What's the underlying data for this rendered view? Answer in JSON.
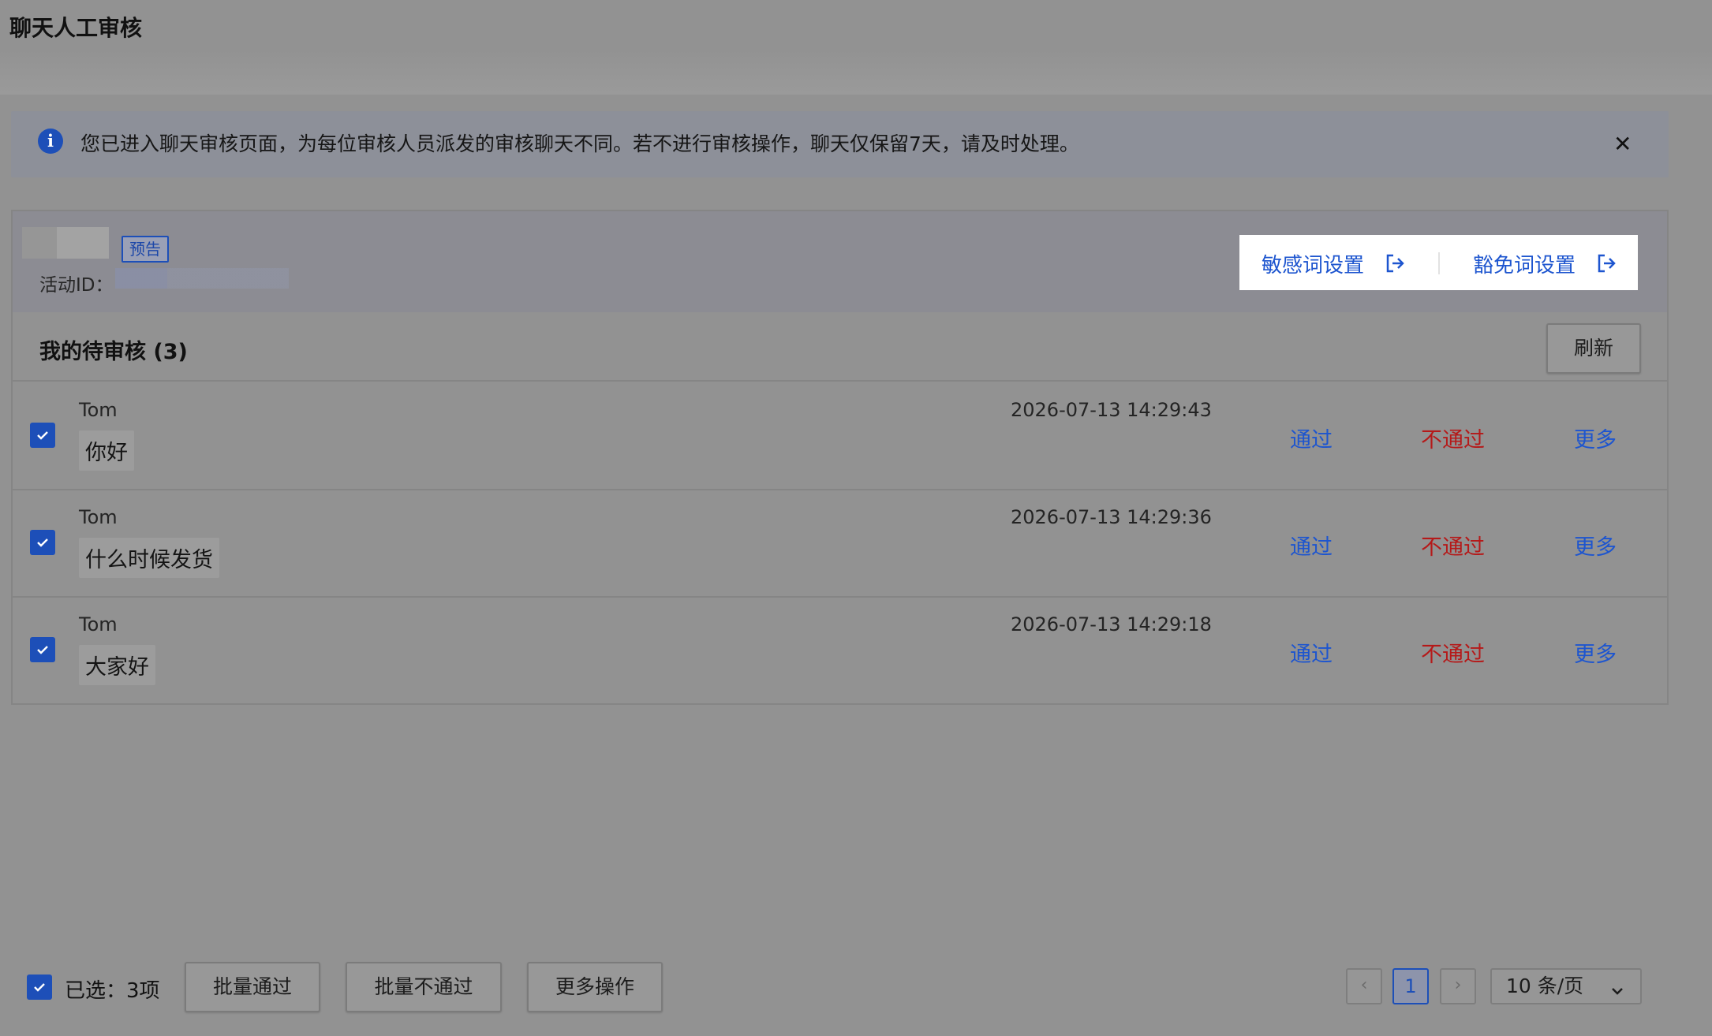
{
  "page": {
    "title": "聊天人工审核"
  },
  "notice": {
    "text": "您已进入聊天审核页面，为每位审核人员派发的审核聊天不同。若不进行审核操作，聊天仅保留7天，请及时处理。",
    "icon": "info-icon",
    "close_icon": "close-icon"
  },
  "activity": {
    "tag": "预告",
    "id_label": "活动ID："
  },
  "links": {
    "sensitive": "敏感词设置",
    "exempt": "豁免词设置",
    "icon": "exit-icon"
  },
  "list": {
    "title": "我的待审核 (3)",
    "refresh_label": "刷新",
    "rows": [
      {
        "user": "Tom",
        "message": "你好",
        "time": "2026-07-13 14:29:43",
        "pass": "通过",
        "reject": "不通过",
        "more": "更多",
        "checked": true
      },
      {
        "user": "Tom",
        "message": "什么时候发货",
        "time": "2026-07-13 14:29:36",
        "pass": "通过",
        "reject": "不通过",
        "more": "更多",
        "checked": true
      },
      {
        "user": "Tom",
        "message": "大家好",
        "time": "2026-07-13 14:29:18",
        "pass": "通过",
        "reject": "不通过",
        "more": "更多",
        "checked": true
      }
    ]
  },
  "footer": {
    "selected_text": "已选：3项",
    "batch_pass": "批量通过",
    "batch_reject": "批量不通过",
    "more_ops": "更多操作",
    "pager": {
      "prev": "‹",
      "current_page": "1",
      "next": "›",
      "page_size": "10 条/页"
    }
  },
  "colors": {
    "accent": "#1d55cf",
    "reject": "#b51919"
  }
}
